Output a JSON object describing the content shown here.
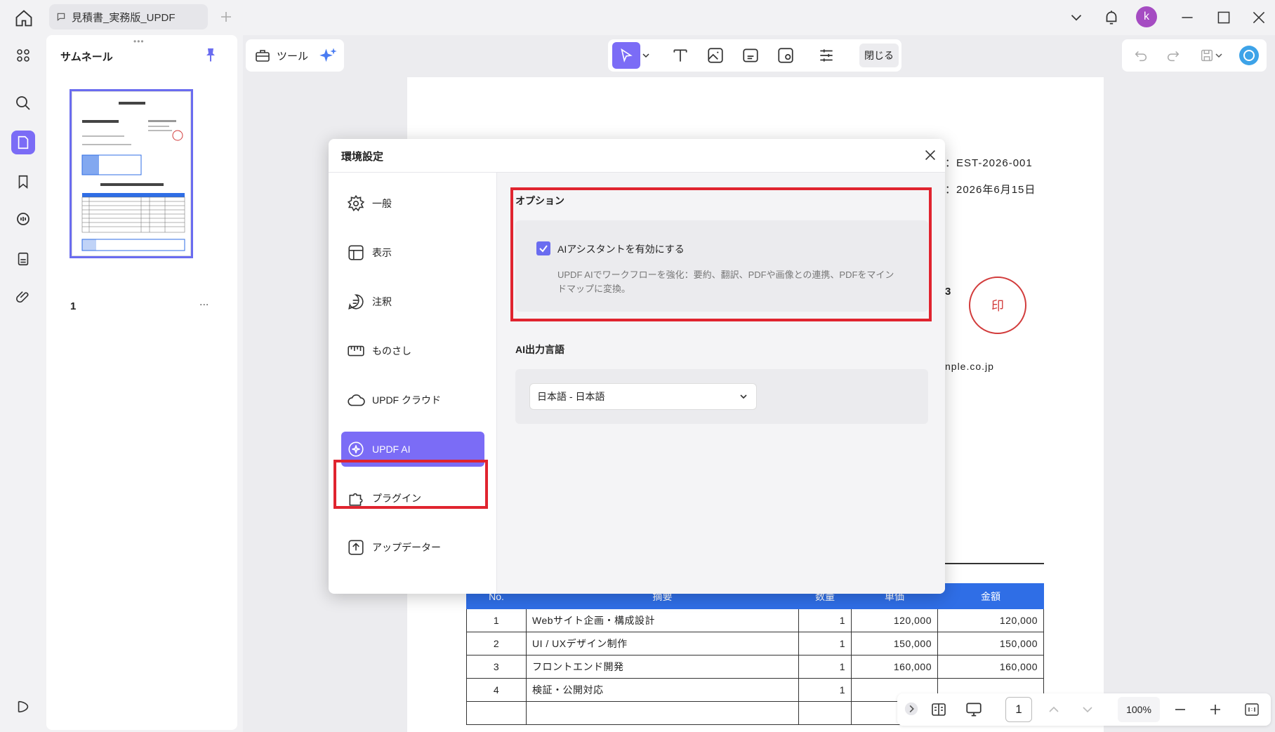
{
  "window": {
    "tab_title": "見積書_実務版_UPDF",
    "avatar_letter": "k"
  },
  "thumbnails": {
    "title": "サムネール",
    "page_number": "1",
    "more": "..."
  },
  "toolbar": {
    "tools_label": "ツール",
    "close_label": "閉じる"
  },
  "document": {
    "estimate_no": "：EST-2026-001",
    "date": "：2026年6月15日",
    "digit_3": "3",
    "stamp": "印",
    "email_fragment": "nple.co.jp",
    "table": {
      "headers": [
        "No.",
        "摘要",
        "数量",
        "単価",
        "金額"
      ],
      "rows": [
        [
          "1",
          "Webサイト企画・構成設計",
          "1",
          "120,000",
          "120,000"
        ],
        [
          "2",
          "UI / UXデザイン制作",
          "1",
          "150,000",
          "150,000"
        ],
        [
          "3",
          "フロントエンド開発",
          "1",
          "160,000",
          "160,000"
        ],
        [
          "4",
          "検証・公開対応",
          "1",
          "",
          ""
        ]
      ]
    }
  },
  "bottombar": {
    "page": "1",
    "zoom": "100%"
  },
  "modal": {
    "title": "環境設定",
    "nav": [
      {
        "label": "一般",
        "icon": "gear-icon"
      },
      {
        "label": "表示",
        "icon": "layout-icon"
      },
      {
        "label": "注釈",
        "icon": "comment-icon"
      },
      {
        "label": "ものさし",
        "icon": "ruler-icon"
      },
      {
        "label": "UPDF クラウド",
        "icon": "cloud-icon"
      },
      {
        "label": "UPDF AI",
        "icon": "ai-icon"
      },
      {
        "label": "プラグイン",
        "icon": "puzzle-icon"
      },
      {
        "label": "アップデーター",
        "icon": "update-icon"
      }
    ],
    "options": {
      "title": "オプション",
      "checkbox_label": "AIアシスタントを有効にする",
      "checkbox_checked": true,
      "description": "UPDF AIでワークフローを強化：要約、翻訳、PDFや画像との連携、PDFをマインドマップに変換。"
    },
    "output_language": {
      "title": "AI出力言語",
      "selected": "日本語 - 日本語"
    }
  },
  "colors": {
    "accent": "#7b6cf6",
    "highlight": "#e0242f",
    "table_header": "#2f6ee6"
  }
}
